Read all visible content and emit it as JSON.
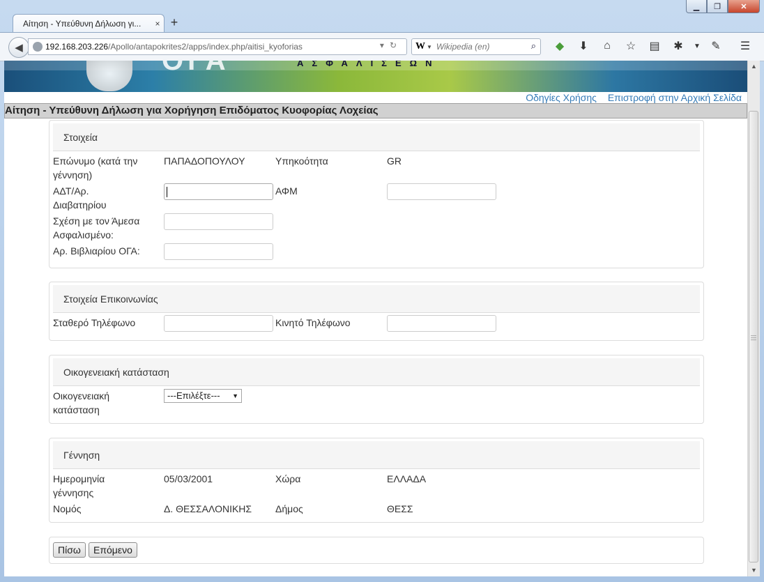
{
  "browser": {
    "tab_title": "Αίτηση - Υπεύθυνη Δήλωση γι...",
    "tab_close": "×",
    "new_tab": "+",
    "url_host": "192.168.203.226",
    "url_path": "/Apollo/antapokrites2/apps/index.php/aitisi_kyoforias",
    "search_placeholder": "Wikipedia (en)",
    "search_engine": "W",
    "window_controls": [
      "minimize",
      "maximize",
      "close"
    ]
  },
  "banner": {
    "letters_large": "ΟΓΑ",
    "letters_small": "ΑΣΦΑΛΙΣΕΩΝ"
  },
  "toplinks": {
    "help": "Οδηγίες Χρήσης",
    "home": "Επιστροφή στην Αρχική Σελίδα"
  },
  "page_title": "Αίτηση - Υπεύθυνη Δήλωση για Χορήγηση Επιδόματος Κυοφορίας Λοχείας",
  "personal": {
    "heading": "Στοιχεία",
    "surname_label": "Επώνυμο (κατά την γέννηση)",
    "surname_value": "ΠΑΠΑΔΟΠΟΥΛΟΥ",
    "citizenship_label": "Υπηκοότητα",
    "citizenship_value": "GR",
    "id_label": "ΑΔΤ/Αρ. Διαβατηρίου",
    "id_value": "",
    "afm_label": "ΑΦΜ",
    "afm_value": "",
    "relation_label": "Σχέση με τον Άμεσα Ασφαλισμένο:",
    "relation_value": "",
    "booklet_label": "Αρ. Βιβλιαρίου ΟΓΑ:",
    "booklet_value": ""
  },
  "contact": {
    "heading": "Στοιχεία Επικοινωνίας",
    "landline_label": "Σταθερό Τηλέφωνο",
    "landline_value": "",
    "mobile_label": "Κινητό Τηλέφωνο",
    "mobile_value": ""
  },
  "family": {
    "heading": "Οικογενειακή κατάσταση",
    "status_label": "Οικογενειακή κατάσταση",
    "status_selected": "---Επιλέξτε---"
  },
  "birth": {
    "heading": "Γέννηση",
    "date_label": "Ημερομηνία γέννησης",
    "date_value": "05/03/2001",
    "country_label": "Χώρα",
    "country_value": "ΕΛΛΑΔΑ",
    "prefecture_label": "Νομός",
    "prefecture_value": "Δ. ΘΕΣΣΑΛΟΝΙΚΗΣ",
    "municipality_label": "Δήμος",
    "municipality_value": "ΘΕΣΣ"
  },
  "buttons": {
    "back": "Πίσω",
    "next": "Επόμενο"
  },
  "colors": {
    "link": "#337ab7",
    "header_bar": "#d1d1d1",
    "panel_heading_bg": "#f5f5f5"
  }
}
